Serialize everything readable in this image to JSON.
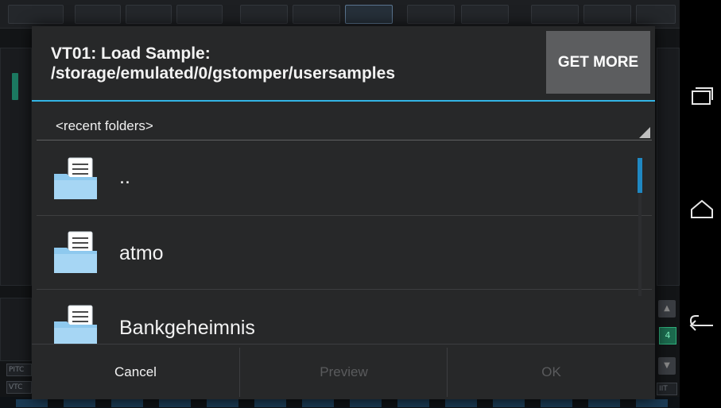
{
  "dialog": {
    "title": "VT01: Load Sample:\n/storage/emulated/0/gstomper/usersamples",
    "title_line1": "VT01: Load Sample:",
    "title_line2": "/storage/emulated/0/gstomper/usersamples",
    "get_more_label": "GET MORE",
    "folder_spinner": {
      "selected": "<recent folders>"
    },
    "files": [
      {
        "name": "..",
        "type": "folder",
        "icon": "folder-document-icon"
      },
      {
        "name": "atmo",
        "type": "folder",
        "icon": "folder-document-icon"
      },
      {
        "name": "Bankgeheimnis",
        "type": "folder",
        "icon": "folder-document-icon"
      }
    ],
    "buttons": {
      "cancel": {
        "label": "Cancel",
        "enabled": true
      },
      "preview": {
        "label": "Preview",
        "enabled": false
      },
      "ok": {
        "label": "OK",
        "enabled": false
      }
    },
    "colors": {
      "accent": "#33b5e5",
      "scrollbar": "#1f88c2",
      "folder_icon": "#8ec9ee",
      "background": "#272829"
    }
  },
  "background_app": {
    "labels": [
      "PITC",
      "VTC",
      "4",
      "IIT"
    ]
  },
  "nav_bar": {
    "icons": [
      "recent-apps-icon",
      "home-icon",
      "back-icon"
    ]
  }
}
